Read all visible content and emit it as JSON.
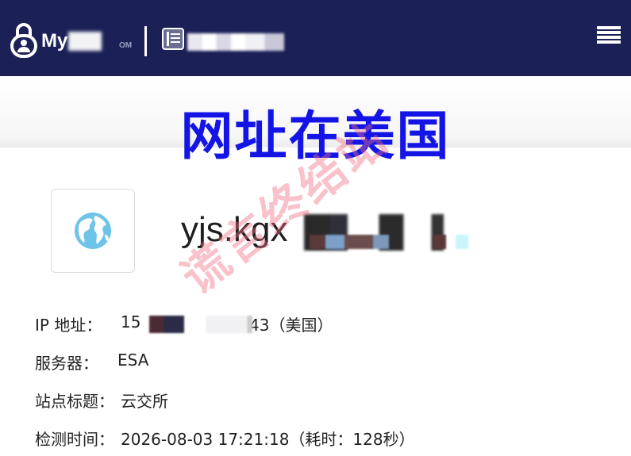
{
  "header": {
    "brand_prefix": "My",
    "brand_suffix": "OM",
    "logo_icon": "padlock-user-icon",
    "site_icon": "document-tool-icon",
    "menu_icon": "hamburger-menu-icon"
  },
  "banner": {
    "title": "网址在美国"
  },
  "site": {
    "icon": "globe-icon",
    "domain": "yjs.kgx"
  },
  "details": {
    "ip_label": "IP 地址：",
    "ip_value_start": "15",
    "ip_value_end": "43（美国）",
    "server_label": "服务器：",
    "server_value": "ESA",
    "title_label": "站点标题：",
    "title_value": "云交所",
    "check_label": "检测时间：",
    "check_value": "2026-08-03 17:21:18（耗时：128秒）"
  },
  "watermark": {
    "text": "谎言终结站"
  },
  "colors": {
    "header_bg": "#1b2156",
    "banner_text": "#1414e6",
    "watermark": "#f06e82"
  }
}
